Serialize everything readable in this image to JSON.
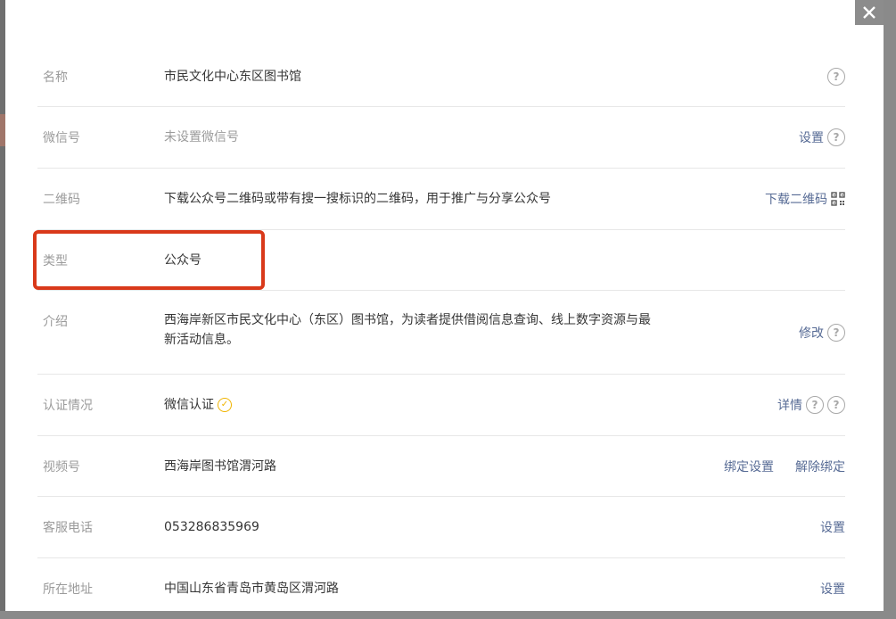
{
  "dialog": {
    "close_label": "✕"
  },
  "rows": [
    {
      "label": "名称",
      "value": "市民文化中心东区图书馆"
    },
    {
      "label": "微信号",
      "value": "未设置微信号",
      "action": "设置"
    },
    {
      "label": "二维码",
      "value": "下载公众号二维码或带有搜一搜标识的二维码，用于推广与分享公众号",
      "action": "下载二维码"
    },
    {
      "label": "类型",
      "value": "公众号"
    },
    {
      "label": "介绍",
      "value_line1": "西海岸新区市民文化中心（东区）图书馆，为读者提供借阅信息查询、线上数字资源与最",
      "value_line2": "新活动信息。",
      "action": "修改"
    },
    {
      "label": "认证情况",
      "value": "微信认证",
      "action": "详情"
    },
    {
      "label": "视频号",
      "value": "西海岸图书馆渭河路",
      "action": "绑定设置",
      "action2": "解除绑定"
    },
    {
      "label": "客服电话",
      "value": "053286835969",
      "action": "设置"
    },
    {
      "label": "所在地址",
      "value": "中国山东省青岛市黄岛区渭河路",
      "action": "设置"
    }
  ],
  "help_glyph": "?",
  "verify_glyph": "✓",
  "icons": {
    "close": "close-icon",
    "help": "help-icon",
    "qr": "qr-code-icon",
    "verified": "verified-check-icon"
  },
  "colors": {
    "link": "#576b95",
    "label": "#9b9b9b",
    "text": "#353535",
    "highlight": "#d9391a",
    "verified": "#f0b400"
  }
}
